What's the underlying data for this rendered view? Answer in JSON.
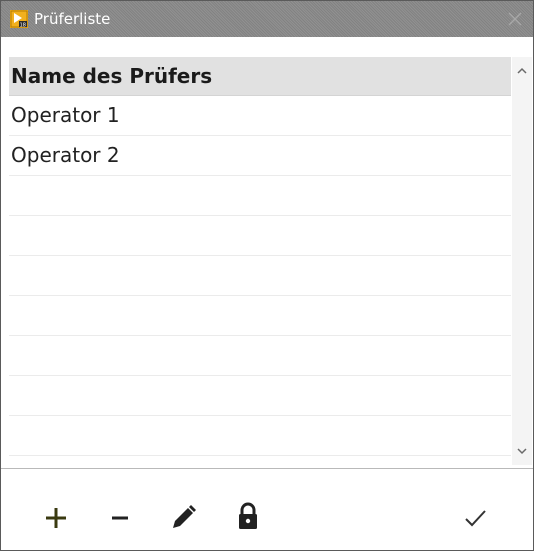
{
  "window": {
    "title": "Prüferliste"
  },
  "list": {
    "header": "Name des Prüfers",
    "rows": [
      "Operator 1",
      "Operator 2",
      "",
      "",
      "",
      "",
      "",
      "",
      ""
    ]
  },
  "toolbar": {
    "icons": [
      "plus-icon",
      "minus-icon",
      "pencil-icon",
      "lock-icon",
      "checkmark-icon"
    ]
  },
  "colors": {
    "titlebar": "#8a8a8a",
    "header_bg": "#e1e1e1",
    "plus_icon": "#3a3a10"
  }
}
